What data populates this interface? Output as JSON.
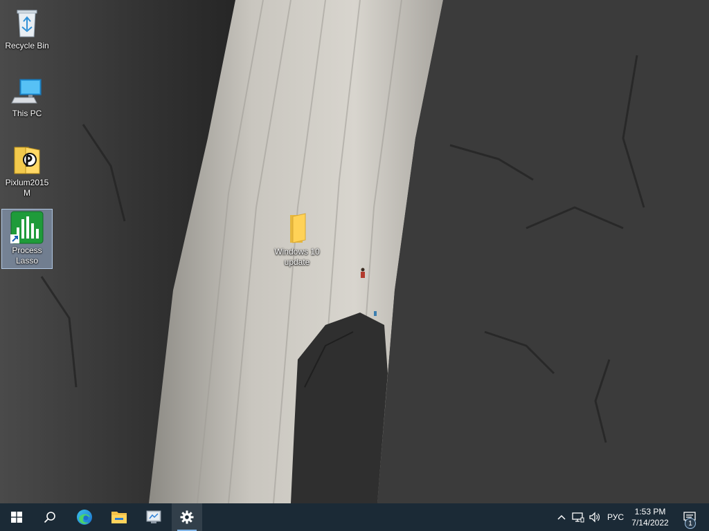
{
  "desktop": {
    "icons": [
      {
        "label": "Recycle Bin",
        "icon": "recycle-bin-icon",
        "selected": false
      },
      {
        "label": "This PC",
        "icon": "this-pc-icon",
        "selected": false
      },
      {
        "label": "Pixlum2015M",
        "icon": "pixlum-icon",
        "selected": false
      },
      {
        "label": "Process Lasso",
        "icon": "process-lasso-icon",
        "selected": true
      },
      {
        "label": "Windows 10 update",
        "icon": "folder-icon",
        "selected": false
      }
    ]
  },
  "taskbar": {
    "buttons": [
      {
        "name": "start",
        "icon": "windows-start-icon"
      },
      {
        "name": "search",
        "icon": "search-icon"
      },
      {
        "name": "edge",
        "icon": "edge-browser-icon"
      },
      {
        "name": "file-explorer",
        "icon": "file-explorer-icon"
      },
      {
        "name": "control-panel",
        "icon": "control-panel-icon"
      },
      {
        "name": "settings",
        "icon": "settings-gear-icon",
        "running": true
      }
    ],
    "tray": {
      "language": "РУС",
      "time": "1:53 PM",
      "date": "7/14/2022",
      "notification_count": "1"
    }
  },
  "colors": {
    "taskbar_bg": "#1b2a36",
    "running_indicator": "#7fb3e6",
    "selection_bg": "#aac8f0"
  }
}
